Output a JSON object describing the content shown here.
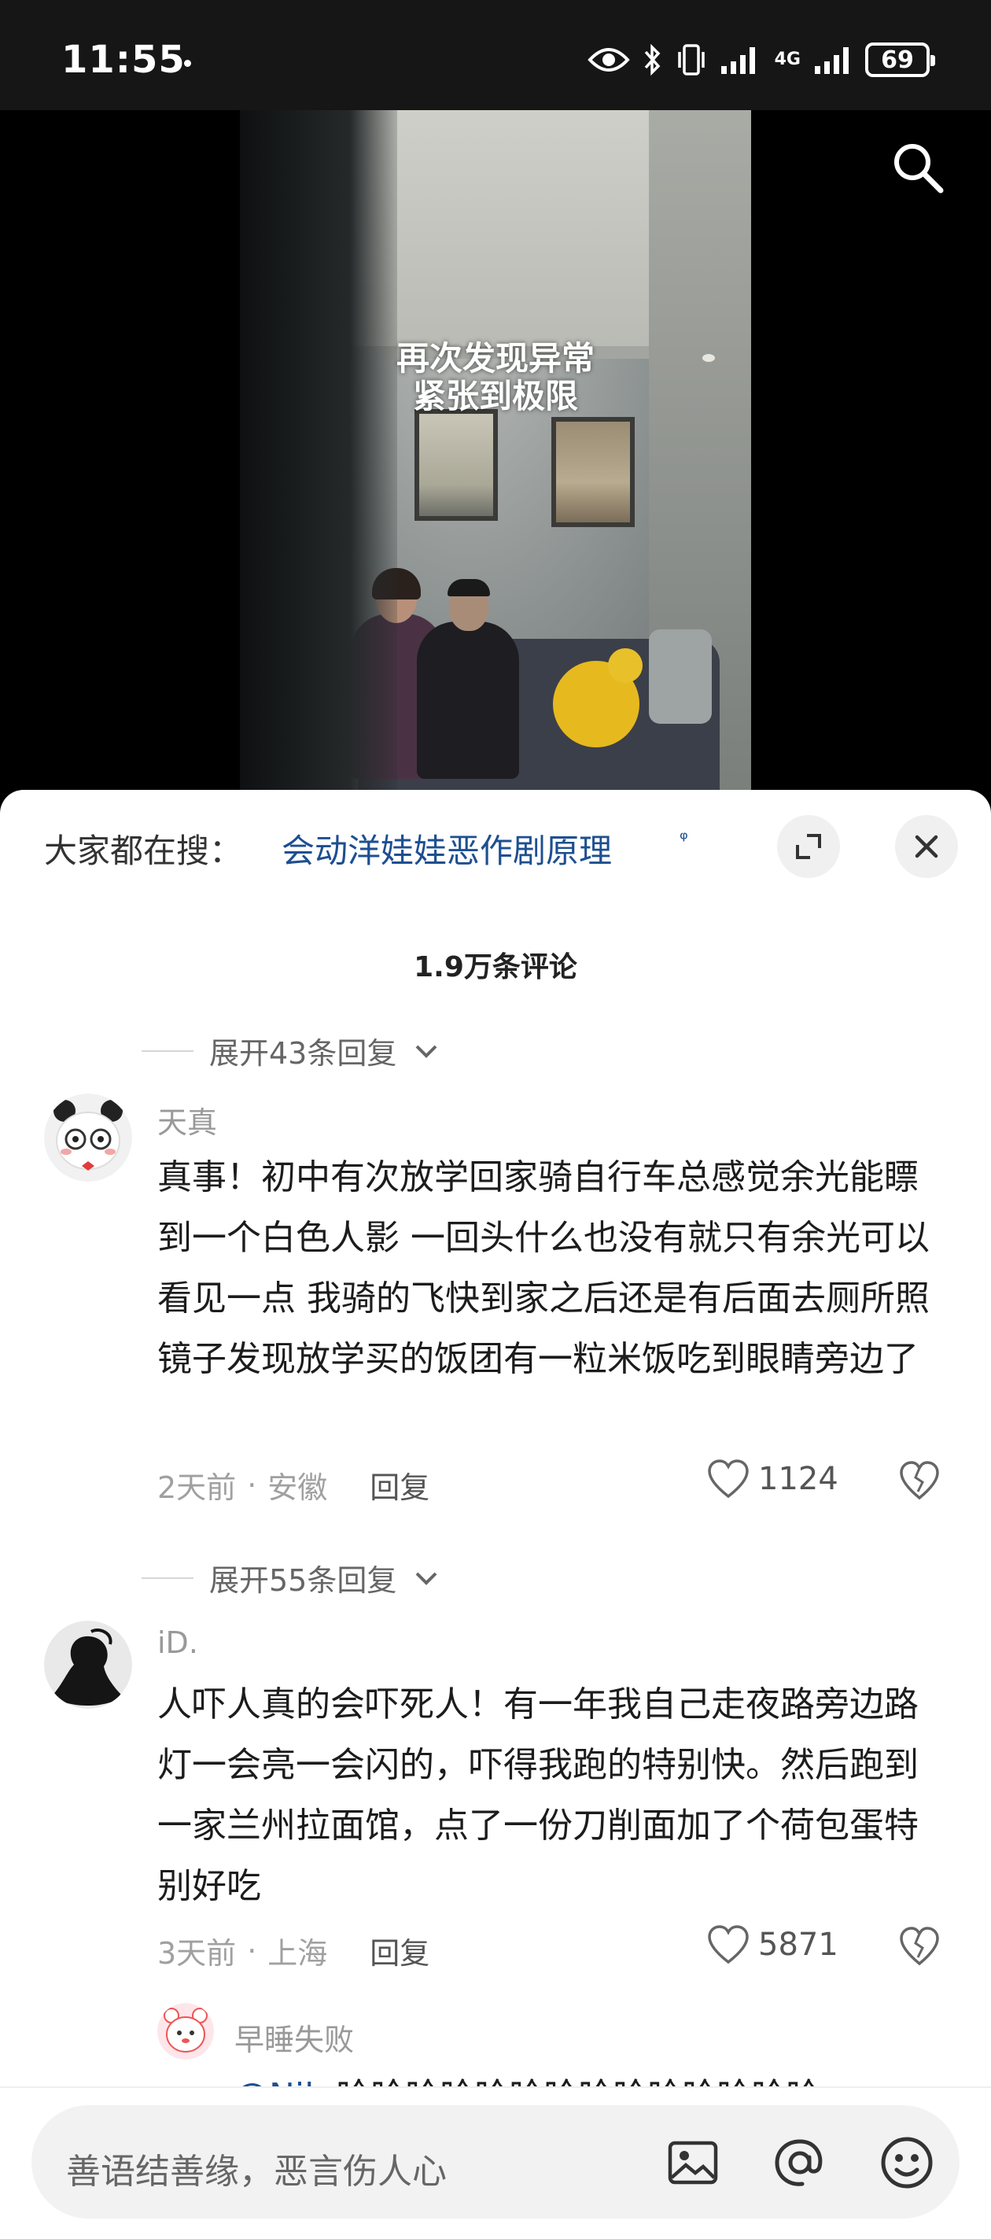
{
  "status_bar": {
    "time": "11:55",
    "battery": "69",
    "network": "4G"
  },
  "video": {
    "caption_line1": "再次发现异常",
    "caption_line2": "紧张到极限"
  },
  "hot_search": {
    "prefix": "大家都在搜：",
    "query": "会动洋娃娃恶作剧原理",
    "query_icon": "ᵠ"
  },
  "comment_count": "1.9万条评论",
  "expand_top": "展开43条回复",
  "comments": [
    {
      "username": "天真",
      "text": "真事！初中有次放学回家骑自行车总感觉余光能瞟到一个白色人影 一回头什么也没有就只有余光可以看见一点 我骑的飞快到家之后还是有后面去厕所照镜子发现放学买的饭团有一粒米饭吃到眼睛旁边了",
      "time": "2天前",
      "location": "安徽",
      "reply": "回复",
      "likes": "1124",
      "expand": "展开55条回复"
    },
    {
      "username": "iD.",
      "text": "人吓人真的会吓死人！有一年我自己走夜路旁边路灯一会亮一会闪的，吓得我跑的特别快。然后跑到一家兰州拉面馆，点了一份刀削面加了个荷包蛋特别好吃",
      "time": "3天前",
      "location": "上海",
      "reply": "回复",
      "likes": "5871"
    }
  ],
  "sub_reply": {
    "username": "早睡失败",
    "mention": "@Nil",
    "text": "哈哈哈哈哈哈哈哈哈哈哈哈哈哈"
  },
  "input": {
    "placeholder": "善语结善缘，恶言伤人心"
  },
  "meta_separator": "·"
}
